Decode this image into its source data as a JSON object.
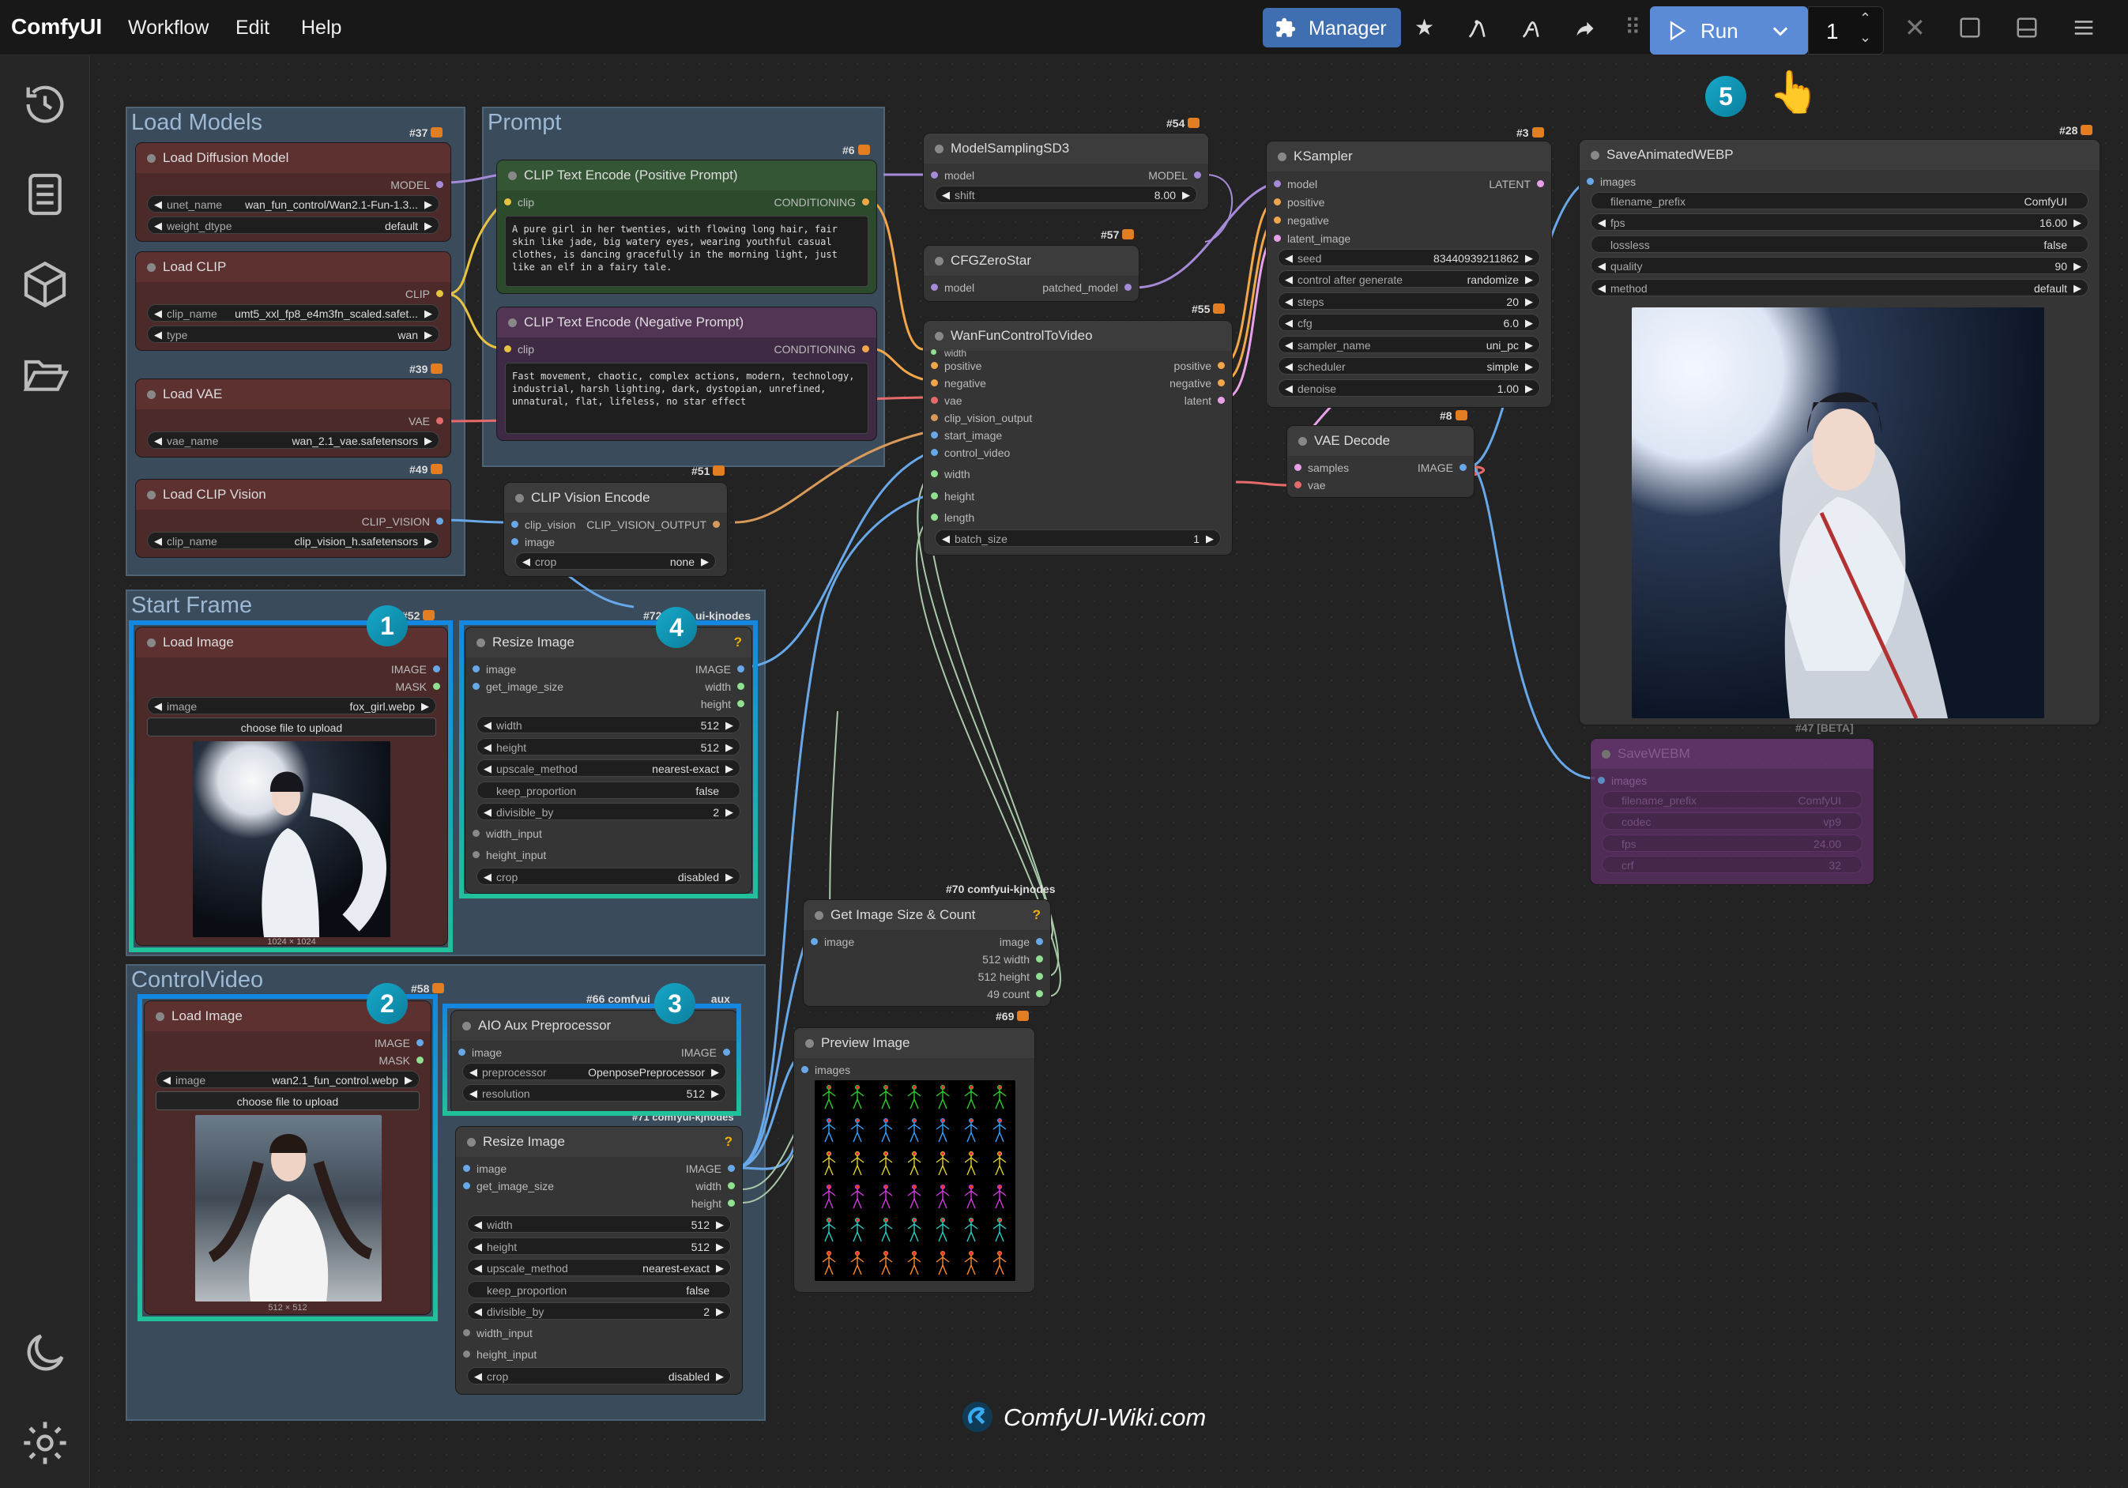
{
  "app": {
    "brand": "ComfyUI",
    "menus": [
      "Workflow",
      "Edit",
      "Help"
    ]
  },
  "toolbar": {
    "manager": "Manager",
    "run": "Run",
    "queue_count": "1"
  },
  "groups": {
    "load_models": "Load Models",
    "prompt": "Prompt",
    "start_frame": "Start Frame",
    "control_video": "ControlVideo"
  },
  "ids": {
    "n37": "#37",
    "n6": "#6",
    "n54": "#54",
    "n3": "#3",
    "n28": "#28",
    "n57": "#57",
    "n55": "#55",
    "n8": "#8",
    "n39": "#39",
    "n49": "#49",
    "n51": "#51",
    "n52": "#52",
    "n72": "#72",
    "n70": "#70 comfyui-kjnodes",
    "n69": "#69",
    "n66": "#66 comfyui_c",
    "n7": "#7",
    "n71": "#71 comfyui-kjnodes",
    "n47": "#47 [BETA]",
    "n58": "#58",
    "aux": "_aux",
    "kjn": "ui-kjnodes"
  },
  "nodes": {
    "load_diffusion": {
      "title": "Load Diffusion Model",
      "out": "MODEL",
      "w1l": "unet_name",
      "w1v": "wan_fun_control/Wan2.1-Fun-1.3...",
      "w2l": "weight_dtype",
      "w2v": "default"
    },
    "load_clip": {
      "title": "Load CLIP",
      "out": "CLIP",
      "w1l": "clip_name",
      "w1v": "umt5_xxl_fp8_e4m3fn_scaled.safet...",
      "w2l": "type",
      "w2v": "wan"
    },
    "load_vae": {
      "title": "Load VAE",
      "out": "VAE",
      "w1l": "vae_name",
      "w1v": "wan_2.1_vae.safetensors"
    },
    "load_clip_vision": {
      "title": "Load CLIP Vision",
      "out": "CLIP_VISION",
      "w1l": "clip_name",
      "w1v": "clip_vision_h.safetensors"
    },
    "clip_pos": {
      "title": "CLIP Text Encode (Positive Prompt)",
      "in": "clip",
      "out": "CONDITIONING",
      "text": "A pure girl in her twenties, with flowing long hair, fair skin like jade, big watery eyes, wearing youthful casual clothes, is dancing gracefully in the morning light, just like an elf in a fairy tale."
    },
    "clip_neg": {
      "title": "CLIP Text Encode (Negative Prompt)",
      "in": "clip",
      "out": "CONDITIONING",
      "text": "Fast movement, chaotic, complex actions, modern, technology, industrial, harsh lighting, dark, dystopian, unrefined, unnatural, flat, lifeless, no star effect"
    },
    "clip_vision_enc": {
      "title": "CLIP Vision Encode",
      "in1": "clip_vision",
      "in2": "image",
      "out": "CLIP_VISION_OUTPUT",
      "w1l": "crop",
      "w1v": "none"
    },
    "model_sampling": {
      "title": "ModelSamplingSD3",
      "in": "model",
      "out": "MODEL",
      "w1l": "shift",
      "w1v": "8.00"
    },
    "cfg_zero": {
      "title": "CFGZeroStar",
      "in": "model",
      "out": "patched_model"
    },
    "wan_fun": {
      "title": "WanFunControlToVideo",
      "in_width": "width",
      "ins": [
        "positive",
        "negative",
        "vae",
        "clip_vision_output",
        "start_image",
        "control_video",
        "width",
        "height",
        "length"
      ],
      "outs": [
        "positive",
        "negative",
        "latent"
      ],
      "w1l": "batch_size",
      "w1v": "1"
    },
    "ksampler": {
      "title": "KSampler",
      "ins": [
        "model",
        "positive",
        "negative",
        "latent_image"
      ],
      "out": "LATENT",
      "widgets": [
        {
          "l": "seed",
          "v": "834409392118​62"
        },
        {
          "l": "control after generate",
          "v": "randomize"
        },
        {
          "l": "steps",
          "v": "20"
        },
        {
          "l": "cfg",
          "v": "6.0"
        },
        {
          "l": "sampler_name",
          "v": "uni_pc"
        },
        {
          "l": "scheduler",
          "v": "simple"
        },
        {
          "l": "denoise",
          "v": "1.00"
        }
      ]
    },
    "vae_decode": {
      "title": "VAE Decode",
      "in1": "samples",
      "in2": "vae",
      "out": "IMAGE"
    },
    "save_webp": {
      "title": "SaveAnimatedWEBP",
      "in": "images",
      "widgets": [
        {
          "l": "filename_prefix",
          "v": "ComfyUI"
        },
        {
          "l": "fps",
          "v": "16.00"
        },
        {
          "l": "lossless",
          "v": "false"
        },
        {
          "l": "quality",
          "v": "90"
        },
        {
          "l": "method",
          "v": "default"
        }
      ]
    },
    "save_webm": {
      "title": "SaveWEBM",
      "in": "images",
      "widgets": [
        {
          "l": "filename_prefix",
          "v": "ComfyUI"
        },
        {
          "l": "codec",
          "v": "vp9"
        },
        {
          "l": "fps",
          "v": "24.00"
        },
        {
          "l": "crf",
          "v": "32"
        }
      ]
    },
    "load_image1": {
      "title": "Load Image",
      "out1": "IMAGE",
      "out2": "MASK",
      "w1l": "image",
      "w1v": "fox_girl.webp",
      "upload": "choose file to upload",
      "size": "1024 × 1024"
    },
    "resize1": {
      "title": "Resize Image",
      "in1": "image",
      "in2": "get_image_size",
      "outs": [
        "IMAGE",
        "width",
        "height"
      ],
      "widgets": [
        {
          "l": "width",
          "v": "512"
        },
        {
          "l": "height",
          "v": "512"
        },
        {
          "l": "upscale_method",
          "v": "nearest-exact"
        },
        {
          "l": "keep_proportion",
          "v": "false"
        },
        {
          "l": "divisible_by",
          "v": "2"
        }
      ],
      "in3": "width_input",
      "in4": "height_input",
      "w6l": "crop",
      "w6v": "disabled"
    },
    "load_image2": {
      "title": "Load Image",
      "out1": "IMAGE",
      "out2": "MASK",
      "w1l": "image",
      "w1v": "wan2.1_fun_control.webp",
      "upload": "choose file to upload",
      "size": "512 × 512"
    },
    "aio": {
      "title": "AIO Aux Preprocessor",
      "in": "image",
      "out": "IMAGE",
      "w1l": "preprocessor",
      "w1v": "OpenposePreprocessor",
      "w2l": "resolution",
      "w2v": "512"
    },
    "resize2": {
      "title": "Resize Image",
      "in1": "image",
      "in2": "get_image_size",
      "outs": [
        "IMAGE",
        "width",
        "height"
      ],
      "widgets": [
        {
          "l": "width",
          "v": "512"
        },
        {
          "l": "height",
          "v": "512"
        },
        {
          "l": "upscale_method",
          "v": "nearest-exact"
        },
        {
          "l": "keep_proportion",
          "v": "false"
        },
        {
          "l": "divisible_by",
          "v": "2"
        }
      ],
      "in3": "width_input",
      "in4": "height_input",
      "w6l": "crop",
      "w6v": "disabled"
    },
    "get_size": {
      "title": "Get Image Size & Count",
      "in": "image",
      "outs": [
        "image",
        "512 width",
        "512 height",
        "49 count"
      ]
    },
    "preview": {
      "title": "Preview Image",
      "in": "images"
    }
  },
  "badges": [
    "1",
    "2",
    "3",
    "4",
    "5"
  ],
  "watermark": "ComfyUI-Wiki.com",
  "colors": {
    "accent": "#5b8bd6",
    "group": "#3a4b5c",
    "highlight_blue": "#1488e0",
    "highlight_green": "#1fc09a"
  }
}
